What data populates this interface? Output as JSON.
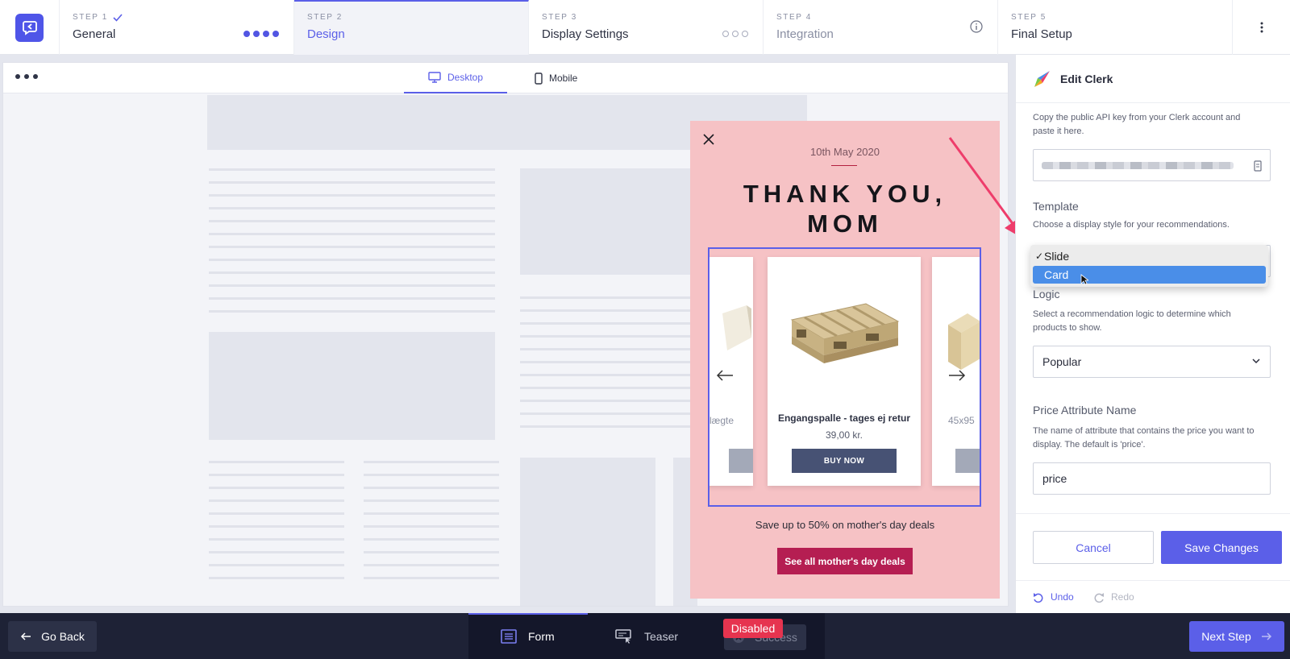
{
  "steps": [
    {
      "num": "STEP 1",
      "name": "General",
      "status": "complete"
    },
    {
      "num": "STEP 2",
      "name": "Design",
      "status": "active"
    },
    {
      "num": "STEP 3",
      "name": "Display Settings",
      "status": "pending"
    },
    {
      "num": "STEP 4",
      "name": "Integration",
      "status": "info"
    },
    {
      "num": "STEP 5",
      "name": "Final Setup",
      "status": "pending"
    }
  ],
  "canvas": {
    "device_tabs": [
      {
        "label": "Desktop",
        "active": true
      },
      {
        "label": "Mobile",
        "active": false
      }
    ]
  },
  "popup": {
    "date": "10th May 2020",
    "title_line1": "THANK YOU,",
    "title_line2": "MOM",
    "product": {
      "name": "Engangspalle - tages ej retur",
      "price": "39,00 kr.",
      "button": "BUY NOW"
    },
    "side_left_name": "lægte",
    "side_right_name": "45x95",
    "subtitle": "Save up to 50% on mother's day deals",
    "cta": "See all mother's day deals",
    "bg_color": "#f6c2c5",
    "cta_color": "#b51e52"
  },
  "panel": {
    "title": "Edit Clerk",
    "api_desc": "Copy the public API key from your Clerk account and paste it here.",
    "template_label": "Template",
    "template_desc": "Choose a display style for your recommendations.",
    "template_options": [
      {
        "label": "Slide",
        "checked": true
      },
      {
        "label": "Card",
        "highlighted": true
      }
    ],
    "logic_label": "Logic",
    "logic_desc": "Select a recommendation logic to determine which products to show.",
    "logic_value": "Popular",
    "price_label": "Price Attribute Name",
    "price_desc": "The name of attribute that contains the price you want to display. The default is 'price'.",
    "price_value": "price",
    "cancel": "Cancel",
    "save": "Save Changes",
    "undo": "Undo",
    "redo": "Redo"
  },
  "bottom": {
    "back": "Go Back",
    "tabs": [
      {
        "label": "Form",
        "active": true
      },
      {
        "label": "Teaser",
        "active": false
      },
      {
        "label": "Success",
        "active": false,
        "disabled": true
      }
    ],
    "disabled_badge": "Disabled",
    "next": "Next Step"
  },
  "colors": {
    "accent": "#5b5fe8",
    "dark": "#1e2236",
    "annotation": "#ee3d6b"
  }
}
